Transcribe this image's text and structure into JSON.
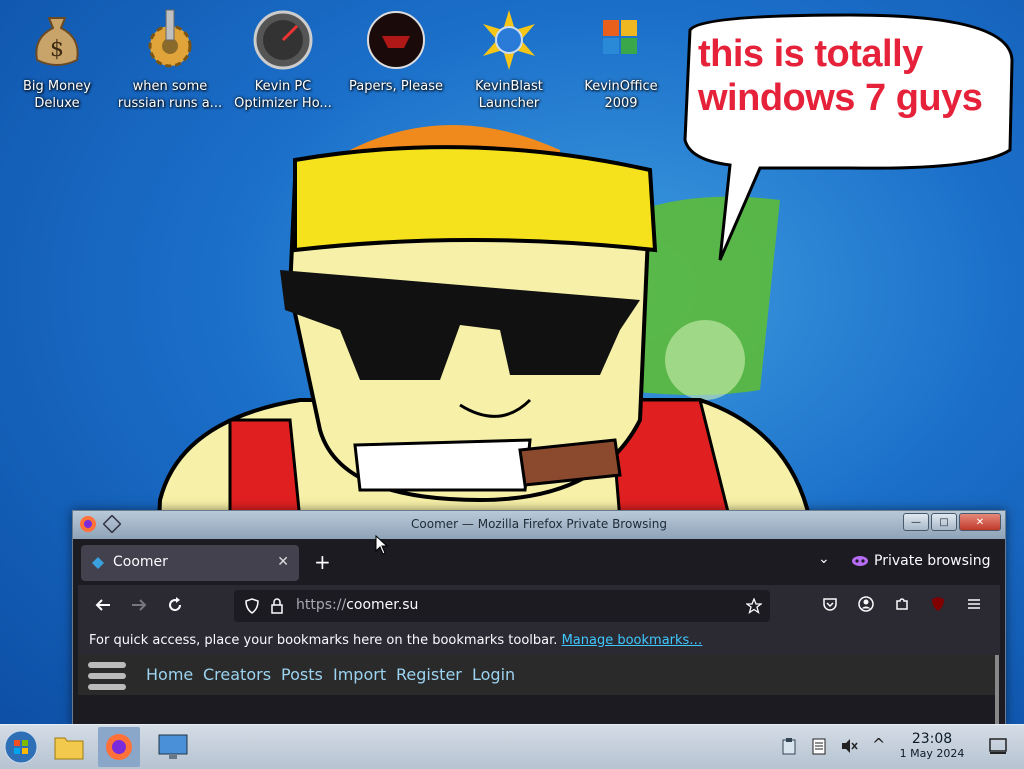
{
  "desktop": {
    "icons": [
      {
        "label": "Big Money\nDeluxe",
        "icon": "money-bag-icon"
      },
      {
        "label": "when some\nrussian runs a...",
        "icon": "gear-icon"
      },
      {
        "label": "Kevin PC\nOptimizer Ho...",
        "icon": "speedometer-icon"
      },
      {
        "label": "Papers, Please",
        "icon": "papers-please-icon"
      },
      {
        "label": "KevinBlast\nLauncher",
        "icon": "starburst-globe-icon"
      },
      {
        "label": "KevinOffice\n2009",
        "icon": "office-icon"
      }
    ],
    "speech_bubble": "this is totally windows 7 guys"
  },
  "window": {
    "title": "Coomer — Mozilla Firefox Private Browsing",
    "controls": {
      "minimize": "—",
      "maximize": "□",
      "close": "✕"
    }
  },
  "browser": {
    "tab": {
      "label": "Coomer",
      "close": "✕"
    },
    "new_tab": "+",
    "tab_list": "⌄",
    "private_label": "Private browsing",
    "url": {
      "scheme": "https://",
      "host": "coomer.su"
    },
    "bookmarks_hint": "For quick access, place your bookmarks here on the bookmarks toolbar.",
    "manage_bookmarks": "Manage bookmarks…"
  },
  "site": {
    "nav": [
      "Home",
      "Creators",
      "Posts",
      "Import",
      "Register",
      "Login"
    ]
  },
  "taskbar": {
    "time": "23:08",
    "date": "1 May 2024",
    "tray_up": "^"
  },
  "colors": {
    "speech_text": "#e5223a",
    "link": "#3fc8ff",
    "site_link": "#9bd3f0"
  }
}
